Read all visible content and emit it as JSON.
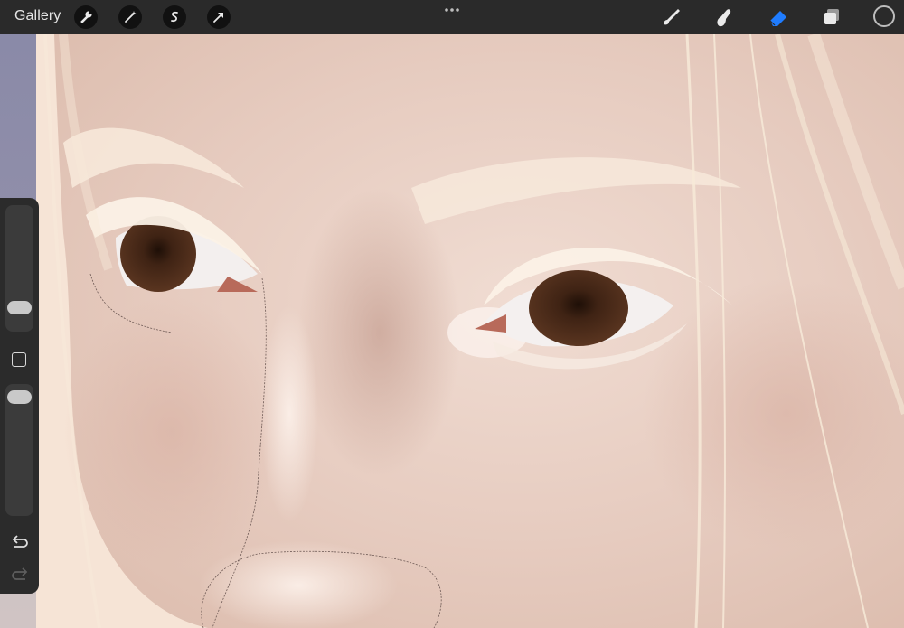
{
  "topbar": {
    "gallery_label": "Gallery",
    "left_tools": [
      "wrench-icon",
      "magic-wand-icon",
      "selection-icon",
      "transform-arrow-icon"
    ],
    "right_tools": [
      "brush-icon",
      "smudge-icon",
      "eraser-icon",
      "layers-icon"
    ],
    "active_tool": "eraser",
    "active_color": "#1f7cff",
    "current_color": "#2a2a2a"
  },
  "sidebar": {
    "brush_size_level": 0.24,
    "opacity_level": 0.93,
    "modify_button_icon": "square-icon",
    "undo_icon": "undo-icon",
    "redo_icon": "redo-icon"
  },
  "canvas": {
    "skin_color": "#ecd3c8",
    "hair_color": "#f7ead9",
    "iris_color": "#4a2a16"
  }
}
